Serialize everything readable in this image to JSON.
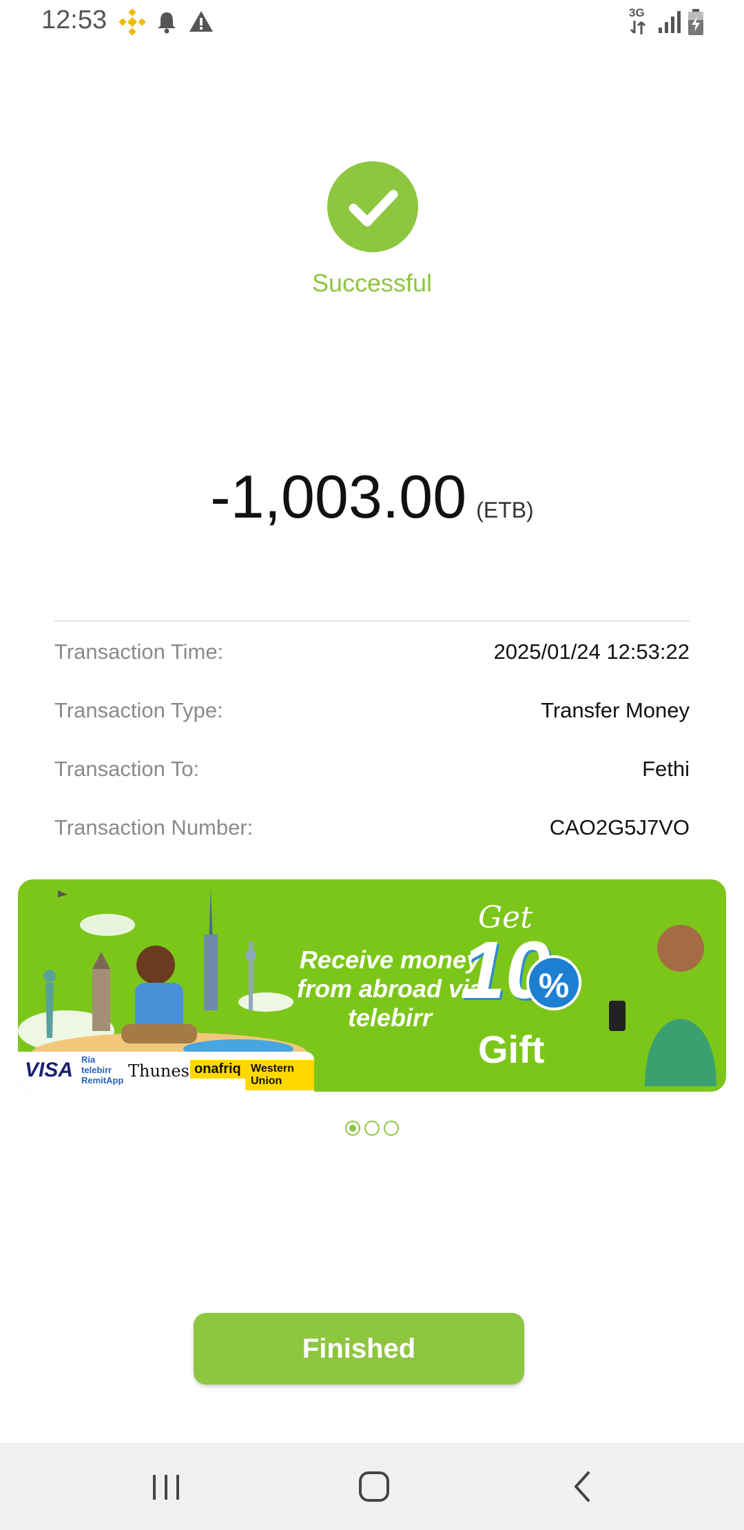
{
  "status_bar": {
    "time": "12:53",
    "network": "3G",
    "icons": [
      "binance-icon",
      "notification-bell-icon",
      "warning-icon",
      "network-3g-icon",
      "signal-icon",
      "battery-charging-icon"
    ]
  },
  "result": {
    "status": "Successful",
    "icon": "check-circle-icon",
    "amount": "-1,003.00",
    "currency": "(ETB)"
  },
  "details": [
    {
      "label": "Transaction Time:",
      "value": "2025/01/24 12:53:22"
    },
    {
      "label": "Transaction Type:",
      "value": "Transfer Money"
    },
    {
      "label": "Transaction To:",
      "value": "Fethi"
    },
    {
      "label": "Transaction Number:",
      "value": "CAO2G5J7VO"
    }
  ],
  "banner": {
    "headline": "Receive money from abroad via telebirr",
    "get": "Get",
    "percent_number": "10",
    "percent_sign": "%",
    "gift": "Gift",
    "partners": [
      "VISA",
      "Ria telebirr RemitApp",
      "Thunes.",
      "onafriq",
      "Western Union"
    ],
    "pages": 3,
    "active_page": 1
  },
  "actions": {
    "finished_label": "Finished"
  },
  "colors": {
    "accent": "#8dc63f",
    "banner_bg": "#7cc61a"
  },
  "nav_bar": {
    "buttons": [
      "recent-apps-icon",
      "home-icon",
      "back-icon"
    ]
  }
}
